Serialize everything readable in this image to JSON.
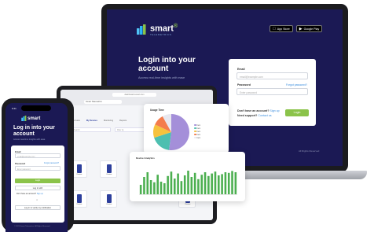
{
  "brand": {
    "name": "smart",
    "tagline": "TELEMETRICS",
    "accent": "#8bc34a",
    "navy": "#1b1954",
    "link": "#3a8dde"
  },
  "laptop": {
    "store_buttons": [
      {
        "icon": "apple-icon",
        "label": "App Store"
      },
      {
        "icon": "google-play-icon",
        "label": "Google Play"
      }
    ],
    "title": "Login into your account",
    "subtitle": "Access real-time insights with ease",
    "form": {
      "email_label": "Email",
      "email_placeholder": "email@example.com",
      "password_label": "Password",
      "forgot_link": "Forgot password?",
      "password_placeholder": "Enter password",
      "no_account_text": "Don't have an account?",
      "signup_link": "Sign up",
      "support_text": "Need support?",
      "contact_link": "Contact us",
      "login_button": "Login"
    },
    "footer": "All Rights Reserved"
  },
  "tablet": {
    "url": "dashboard.smart.com",
    "tab": "Smart Telemetrics",
    "nav_tabs": [
      "Overview",
      "My Devices",
      "Monitoring",
      "Reports"
    ],
    "search_fields": [
      "Search",
      "Filter by",
      "Status"
    ],
    "device_tiles": [
      "Device",
      "Device",
      "Device",
      "Device",
      "Device",
      "Device"
    ]
  },
  "pie_card": {
    "title": "Usage Time",
    "chart_data": {
      "type": "pie",
      "values": [
        52,
        18,
        12,
        10,
        8
      ],
      "colors": [
        "#a48fd9",
        "#4dbfb0",
        "#f6c23e",
        "#f47c4c",
        "#e8e8ef"
      ],
      "legend": [
        "Item",
        "Item",
        "Item",
        "Item",
        "Item"
      ]
    }
  },
  "bar_card": {
    "title": "Device Analytics",
    "chart_data": {
      "type": "bar",
      "values": [
        30,
        55,
        70,
        45,
        38,
        62,
        40,
        35,
        58,
        72,
        50,
        66,
        42,
        60,
        75,
        55,
        68,
        48,
        62,
        70,
        58,
        66,
        72,
        60,
        64,
        70,
        68,
        74,
        70
      ],
      "color": "#4caf50"
    }
  },
  "phone": {
    "time": "9:41",
    "title": "Log in into your account",
    "subtitle": "Access real-time insights with ease",
    "form": {
      "email_label": "Email",
      "email_placeholder": "email@example.com",
      "password_label": "Password",
      "forgot_link": "Forgot password?",
      "password_placeholder": "Enter password",
      "login_button": "Login",
      "google_button": "Log in with",
      "no_account_text": "Don't have an account?",
      "signup_link": "Sign up",
      "divider": "or",
      "verify_button": "Log in to verify my notification"
    },
    "footer": "© 2024 Smart Telemetrics. All Rights Reserved"
  }
}
